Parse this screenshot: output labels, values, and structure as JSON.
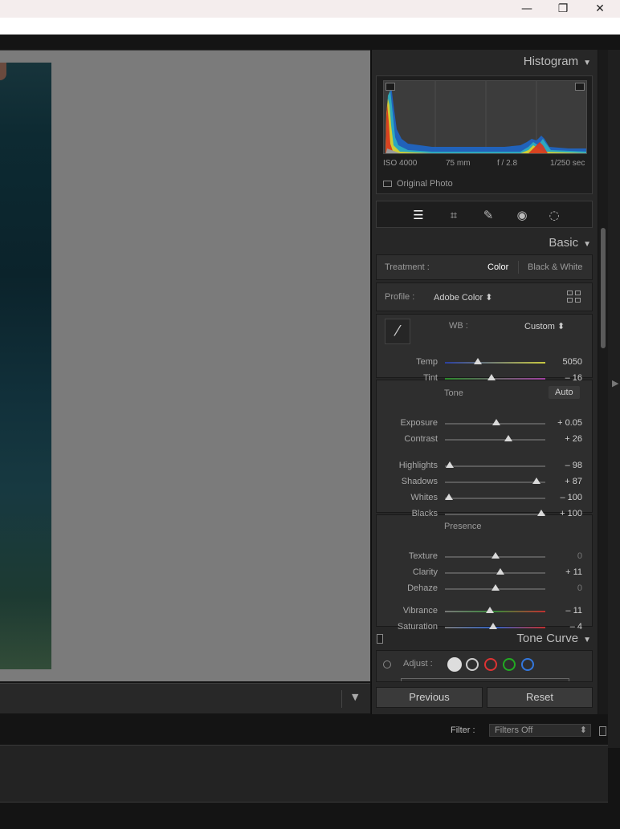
{
  "window": {
    "minimize": "—",
    "maximize": "❐",
    "close": "✕"
  },
  "histogram": {
    "title": "Histogram",
    "iso": "ISO 4000",
    "focal": "75 mm",
    "aperture": "f / 2.8",
    "shutter": "1/250 sec",
    "original_photo": "Original Photo"
  },
  "basic": {
    "title": "Basic",
    "treatment_label": "Treatment :",
    "treatment_color": "Color",
    "treatment_bw": "Black & White",
    "profile_label": "Profile :",
    "profile_value": "Adobe Color ⬍",
    "wb_label": "WB :",
    "wb_value": "Custom ⬍",
    "tone_label": "Tone",
    "auto_label": "Auto",
    "presence_label": "Presence"
  },
  "sliders": [
    {
      "label": "Temp",
      "value": "5050",
      "level": 0.33
    },
    {
      "label": "Tint",
      "value": "– 16",
      "level": 0.46
    },
    {
      "label": "Exposure",
      "value": "+ 0.05",
      "level": 0.51
    },
    {
      "label": "Contrast",
      "value": "+ 26",
      "level": 0.63
    },
    {
      "label": "Highlights",
      "value": "– 98",
      "level": 0.05
    },
    {
      "label": "Shadows",
      "value": "+ 87",
      "level": 0.91
    },
    {
      "label": "Whites",
      "value": "– 100",
      "level": 0.04
    },
    {
      "label": "Blacks",
      "value": "+ 100",
      "level": 0.96
    },
    {
      "label": "Texture",
      "value": "0",
      "level": 0.5
    },
    {
      "label": "Clarity",
      "value": "+ 11",
      "level": 0.55
    },
    {
      "label": "Dehaze",
      "value": "0",
      "level": 0.5
    },
    {
      "label": "Vibrance",
      "value": "– 11",
      "level": 0.45
    },
    {
      "label": "Saturation",
      "value": "– 4",
      "level": 0.48
    }
  ],
  "tone_curve": {
    "title": "Tone Curve",
    "adjust_label": "Adjust :"
  },
  "buttons": {
    "previous": "Previous",
    "reset": "Reset"
  },
  "filter": {
    "label": "Filter :",
    "value": "Filters Off"
  },
  "colors": {
    "panel": "#272727",
    "canvas": "#7b7b7b",
    "accent_red": "#d33",
    "accent_green": "#2a2",
    "accent_blue": "#37d"
  }
}
